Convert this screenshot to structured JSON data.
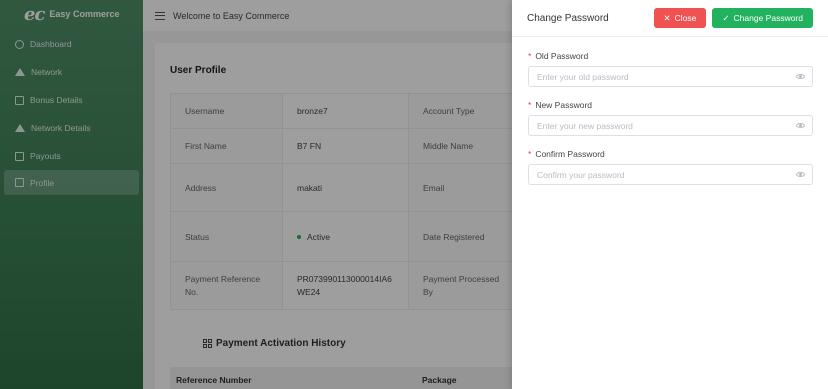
{
  "brand": {
    "logo": "ec",
    "name": "Easy Commerce"
  },
  "sidebar": {
    "items": [
      {
        "label": "Dashboard"
      },
      {
        "label": "Network"
      },
      {
        "label": "Bonus Details"
      },
      {
        "label": "Network Details"
      },
      {
        "label": "Payouts"
      },
      {
        "label": "Profile"
      }
    ]
  },
  "header": {
    "title": "Welcome to Easy Commerce"
  },
  "profile": {
    "title": "User Profile",
    "rows": [
      {
        "l1": "Username",
        "v1": "bronze7",
        "l2": "Account Type"
      },
      {
        "l1": "First Name",
        "v1": "B7 FN",
        "l2": "Middle Name"
      },
      {
        "l1": "Address",
        "v1": "makati",
        "l2": "Email"
      },
      {
        "l1": "Status",
        "v1": "Active",
        "l2": "Date Registered"
      },
      {
        "l1": "Payment Reference No.",
        "v1": "PR073990113000014IA6WE24",
        "l2": "Payment Processed By"
      }
    ]
  },
  "history": {
    "title": "Payment Activation History",
    "columns": [
      "Reference Number",
      "Package"
    ]
  },
  "drawer": {
    "title": "Change Password",
    "close_label": "Close",
    "submit_label": "Change Password",
    "fields": [
      {
        "label": "Old Password",
        "placeholder": "Enter your old password",
        "value": ""
      },
      {
        "label": "New Password",
        "placeholder": "Enter your new password",
        "value": ""
      },
      {
        "label": "Confirm Password",
        "placeholder": "Confirm your password",
        "value": ""
      }
    ]
  },
  "colors": {
    "sidebar": "#3c7f56",
    "danger": "#f05252",
    "success": "#22b25f"
  }
}
